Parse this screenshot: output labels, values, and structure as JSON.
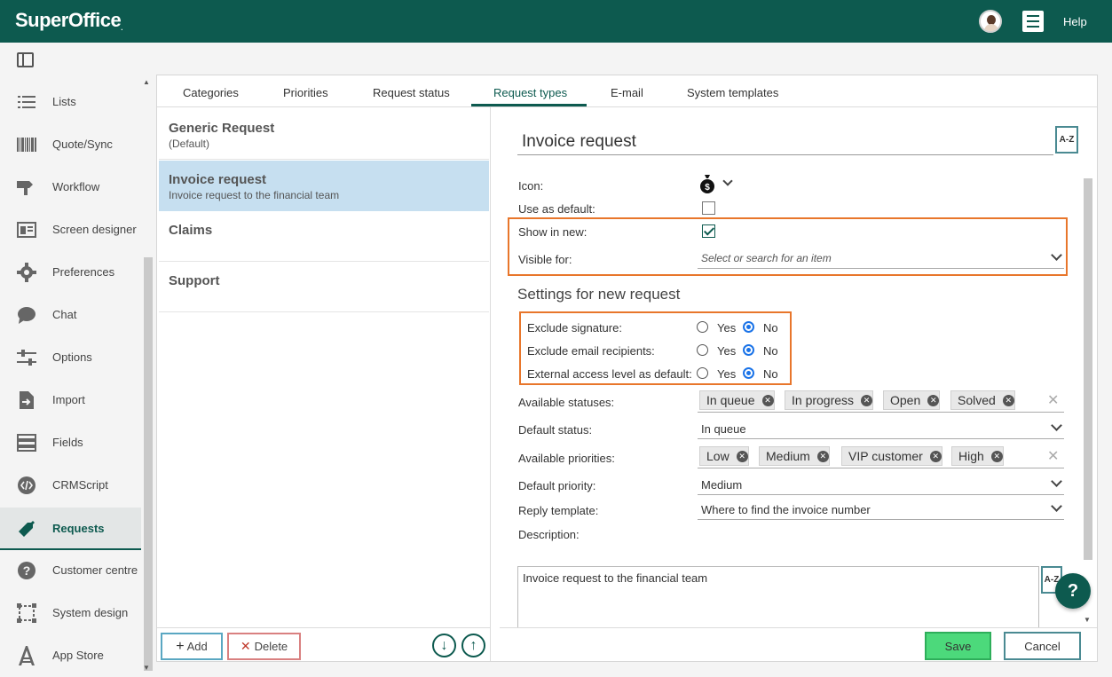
{
  "app": {
    "logo_text": "SuperOffice",
    "logo_mark": ".",
    "help_label": "Help"
  },
  "icons": {
    "avatar": "user-avatar",
    "menu": "hamburger-menu-icon",
    "sidebar_toggle": "sidebar-toggle-icon",
    "bag": "money-bag-icon",
    "chevron": "chevron-down-icon"
  },
  "colors": {
    "brand": "#0d5a4f",
    "highlight": "#e8762b",
    "selected_row": "#c6dff0",
    "save": "#4cd97b"
  },
  "sidebar": {
    "items": [
      {
        "label": "Lists",
        "icon": "list-icon"
      },
      {
        "label": "Quote/Sync",
        "icon": "barcode-icon"
      },
      {
        "label": "Workflow",
        "icon": "workflow-icon"
      },
      {
        "label": "Screen designer",
        "icon": "screen-designer-icon"
      },
      {
        "label": "Preferences",
        "icon": "gear-icon"
      },
      {
        "label": "Chat",
        "icon": "chat-icon"
      },
      {
        "label": "Options",
        "icon": "sliders-icon"
      },
      {
        "label": "Import",
        "icon": "import-icon"
      },
      {
        "label": "Fields",
        "icon": "fields-icon"
      },
      {
        "label": "CRMScript",
        "icon": "code-icon"
      },
      {
        "label": "Requests",
        "icon": "requests-icon",
        "active": true
      },
      {
        "label": "Customer centre",
        "icon": "question-icon"
      },
      {
        "label": "System design",
        "icon": "system-design-icon"
      },
      {
        "label": "App Store",
        "icon": "app-store-icon"
      }
    ]
  },
  "tabs": [
    "Categories",
    "Priorities",
    "Request status",
    "Request types",
    "E-mail",
    "System templates"
  ],
  "active_tab": "Request types",
  "request_types": [
    {
      "title": "Generic Request",
      "subtitle": "(Default)"
    },
    {
      "title": "Invoice request",
      "subtitle": "Invoice request to the financial team",
      "selected": true
    },
    {
      "title": "Claims",
      "subtitle": ""
    },
    {
      "title": "Support",
      "subtitle": ""
    }
  ],
  "list_footer": {
    "add_label": "Add",
    "delete_label": "Delete"
  },
  "details": {
    "name": "Invoice request",
    "az_label": "A-Z",
    "icon_label": "Icon:",
    "use_as_default_label": "Use as default:",
    "use_as_default": false,
    "show_in_new_label": "Show in new:",
    "show_in_new": true,
    "visible_for_label": "Visible for:",
    "visible_for_placeholder": "Select or search for an item",
    "settings_title": "Settings for new request",
    "settings": [
      {
        "label": "Exclude signature:",
        "value": "No"
      },
      {
        "label": "Exclude email recipients:",
        "value": "No"
      },
      {
        "label": "External access level as default:",
        "value": "No"
      }
    ],
    "yes_label": "Yes",
    "no_label": "No",
    "available_statuses_label": "Available statuses:",
    "available_statuses": [
      "In queue",
      "In progress",
      "Open",
      "Solved"
    ],
    "default_status_label": "Default status:",
    "default_status": "In queue",
    "available_priorities_label": "Available priorities:",
    "available_priorities": [
      "Low",
      "Medium",
      "VIP customer",
      "High"
    ],
    "default_priority_label": "Default priority:",
    "default_priority": "Medium",
    "reply_template_label": "Reply template:",
    "reply_template": "Where to find the invoice number",
    "description_label": "Description:",
    "description": "Invoice request to the financial team"
  },
  "footer": {
    "save_label": "Save",
    "cancel_label": "Cancel"
  },
  "help_fab_label": "?"
}
